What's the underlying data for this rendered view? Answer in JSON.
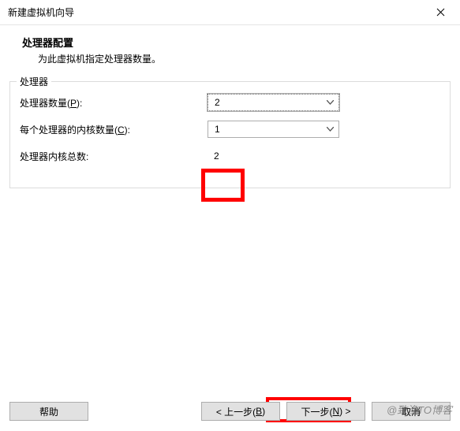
{
  "window": {
    "title": "新建虚拟机向导"
  },
  "header": {
    "title": "处理器配置",
    "subtitle": "为此虚拟机指定处理器数量。"
  },
  "fieldset": {
    "legend": "处理器",
    "processor_count_label_pre": "处理器数量(",
    "processor_count_mnemonic": "P",
    "processor_count_label_post": "):",
    "processor_count_value": "2",
    "cores_per_processor_label_pre": "每个处理器的内核数量(",
    "cores_per_processor_mnemonic": "C",
    "cores_per_processor_label_post": "):",
    "cores_per_processor_value": "1",
    "total_cores_label": "处理器内核总数:",
    "total_cores_value": "2"
  },
  "footer": {
    "help": "帮助",
    "back_pre": "< 上一步(",
    "back_mnemonic": "B",
    "back_post": ")",
    "next_pre": "下一步(",
    "next_mnemonic": "N",
    "next_post": ") >",
    "cancel": "取消"
  },
  "watermark": "@致渔TO博客"
}
